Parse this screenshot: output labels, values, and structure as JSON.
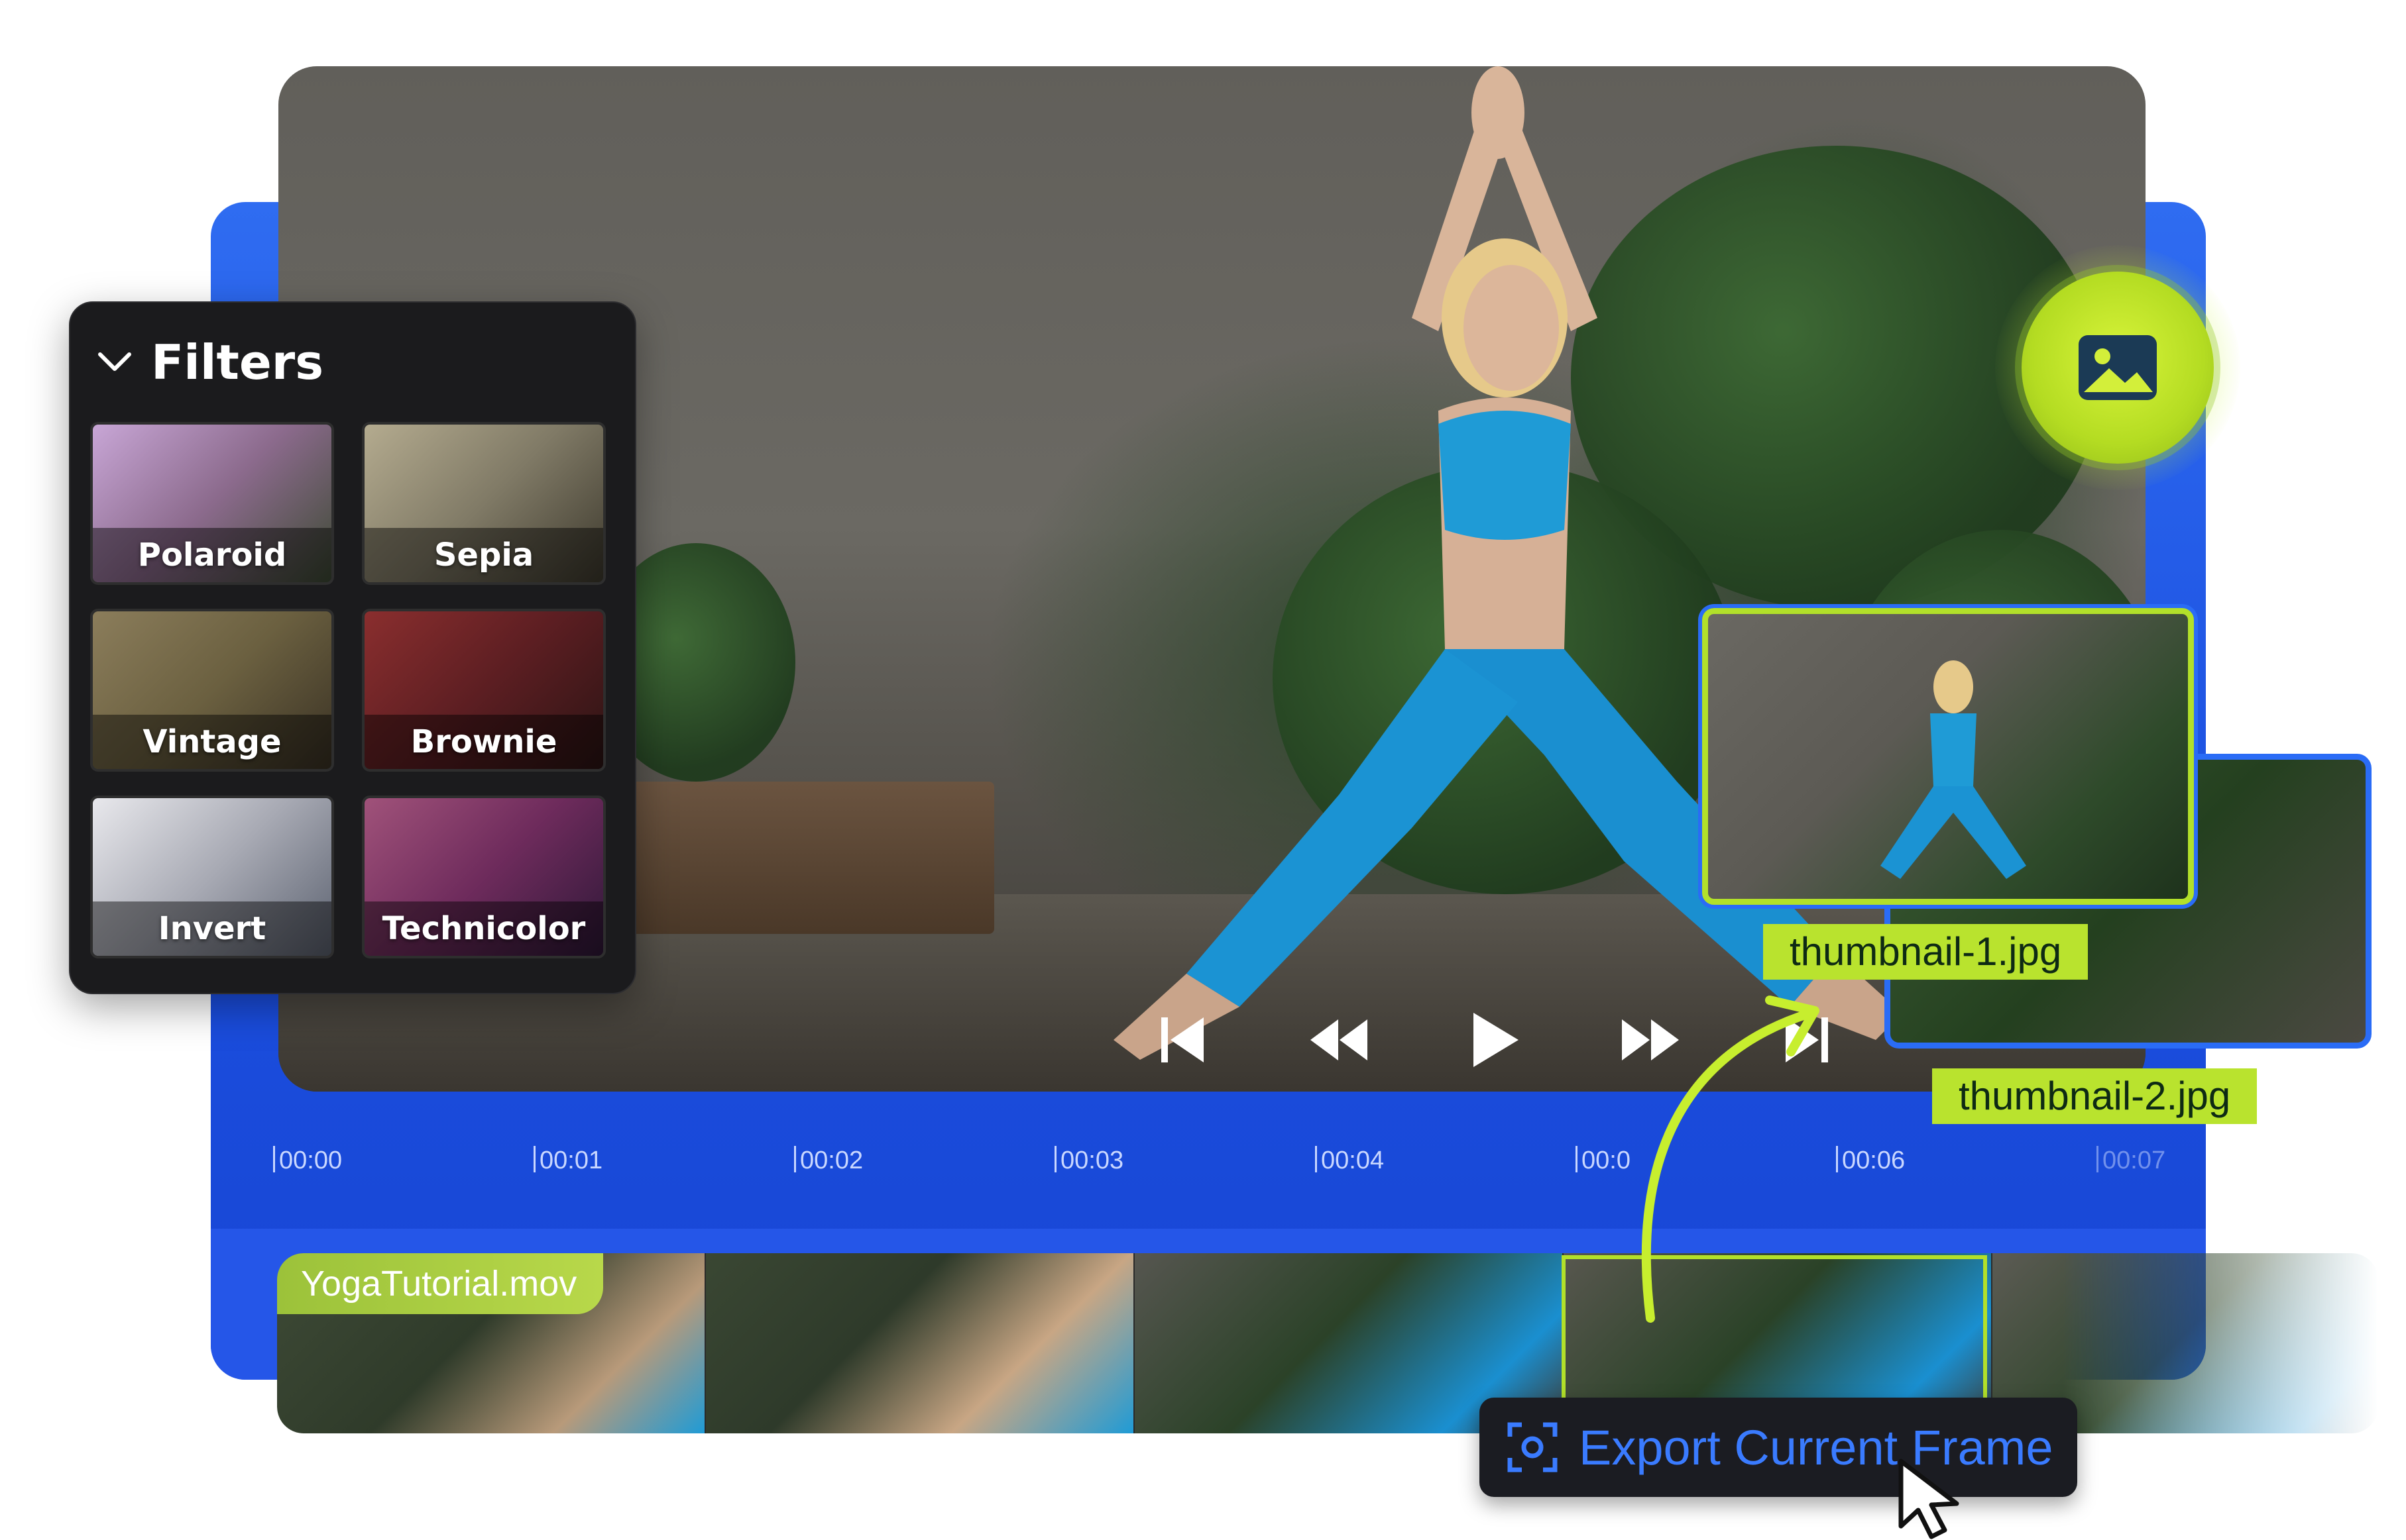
{
  "filters": {
    "title": "Filters",
    "items": [
      {
        "label": "Polaroid"
      },
      {
        "label": "Sepia"
      },
      {
        "label": "Vintage"
      },
      {
        "label": "Brownie"
      },
      {
        "label": "Invert"
      },
      {
        "label": "Technicolor"
      }
    ]
  },
  "playback": {
    "controls": [
      "skip-to-start-icon",
      "rewind-icon",
      "play-icon",
      "fast-forward-icon",
      "skip-to-end-icon"
    ]
  },
  "timeline": {
    "ticks": [
      "00:00",
      "00:01",
      "00:02",
      "00:03",
      "00:04",
      "00:0",
      "00:06",
      "00:07"
    ]
  },
  "clip": {
    "file_name": "YogaTutorial.mov"
  },
  "thumbnails": [
    {
      "name": "thumbnail-1.jpg"
    },
    {
      "name": "thumbnail-2.jpg"
    }
  ],
  "export": {
    "label": "Export Current Frame",
    "icon": "screenshot-capture-icon"
  },
  "colors": {
    "accent_blue": "#1f55e6",
    "accent_green": "#b2e02a",
    "panel_dark": "#1b1b1d"
  }
}
